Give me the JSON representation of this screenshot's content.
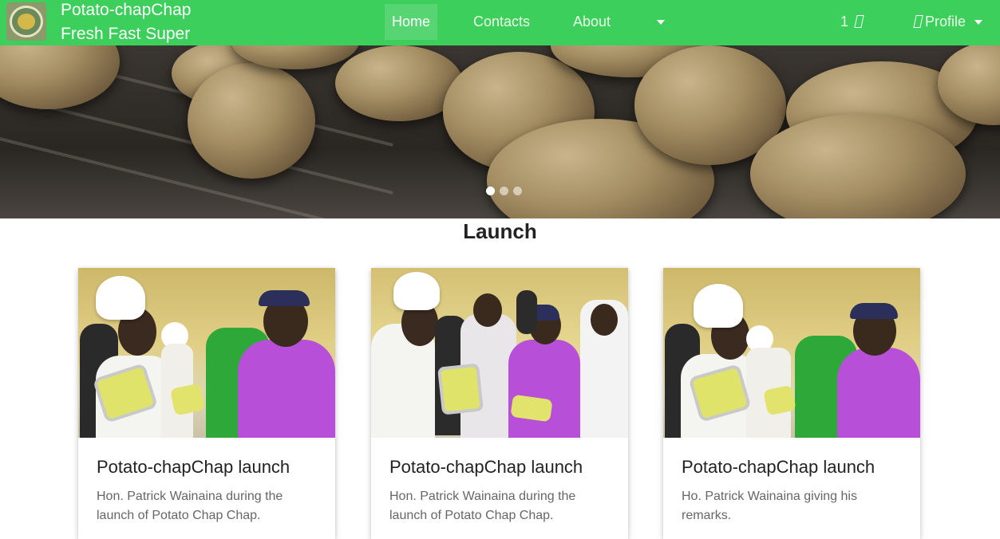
{
  "brand": {
    "line1": "Potato-chapChap",
    "line2": "Fresh Fast Super"
  },
  "nav": {
    "home": "Home",
    "contacts": "Contacts",
    "about": "About",
    "cart_count": "1",
    "profile": "Profile"
  },
  "carousel": {
    "slides": 3,
    "active_index": 0
  },
  "section": {
    "title": "Launch"
  },
  "cards": [
    {
      "title": "Potato-chapChap launch",
      "text": "Hon. Patrick Wainaina during the launch of Potato Chap Chap."
    },
    {
      "title": "Potato-chapChap launch",
      "text": "Hon. Patrick Wainaina during the launch of Potato Chap Chap."
    },
    {
      "title": "Potato-chapChap launch",
      "text": "Ho. Patrick Wainaina giving his remarks."
    }
  ],
  "colors": {
    "navbar": "#3ccf5c",
    "shirt_purple": "#b84fd8",
    "shirt_green": "#2fa83a"
  }
}
